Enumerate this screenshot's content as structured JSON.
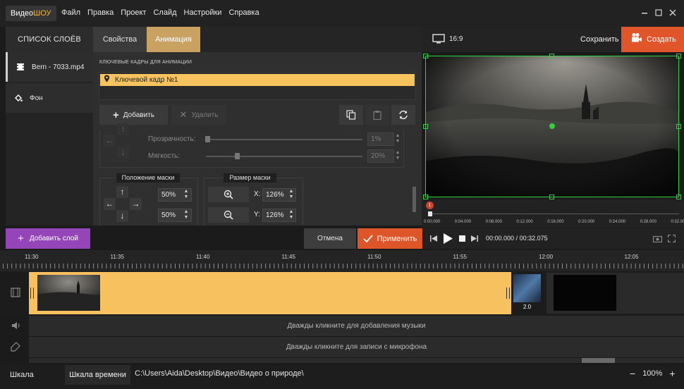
{
  "app": {
    "brand_part1": "Видео",
    "brand_part2": "ШОУ",
    "menu": [
      "Файл",
      "Правка",
      "Проект",
      "Слайд",
      "Настройки",
      "Справка"
    ]
  },
  "layers": {
    "header": "СПИСОК СЛОЁВ",
    "items": [
      {
        "label": "Bern - 7033.mp4",
        "icon": "film-icon"
      },
      {
        "label": "Фон",
        "icon": "paint-bucket-icon"
      }
    ],
    "add_button": "Добавить слой"
  },
  "editor": {
    "tabs": [
      "Свойства",
      "Анимация"
    ],
    "active_tab": "Анимация",
    "keyframes_title": "КЛЮЧЕВЫЕ КАДРЫ ДЛЯ АНИМАЦИИ",
    "keyframes": [
      "Ключевой кадр №1"
    ],
    "add_label": "Добавить",
    "delete_label": "Удалить",
    "opacity_label": "Прозрачность:",
    "opacity_value": "1%",
    "opacity_level": 0.01,
    "softness_label": "Мягкость:",
    "softness_value": "20%",
    "softness_level": 0.2,
    "mask_position_title": "Положение маски",
    "mask_pos_x": "50%",
    "mask_pos_y": "50%",
    "mask_size_title": "Размер маски",
    "size_x_label": "X:",
    "size_x": "126%",
    "size_y_label": "Y:",
    "size_y": "126%",
    "cancel_label": "Отмена",
    "apply_label": "Применить"
  },
  "preview": {
    "aspect": "16:9",
    "save_label": "Сохранить",
    "create_label": "Создать",
    "marker_number": "1",
    "time_ticks": [
      "0:00.000",
      "0:04.000",
      "0:08.000",
      "0:12.000",
      "0:16.000",
      "0:20.000",
      "0:24.000",
      "0:28.000",
      "0:32.000"
    ],
    "current_time": "00:00.000",
    "total_time": "/ 00:32.075",
    "progress": 0
  },
  "timeline": {
    "labels": [
      "11:30",
      "11:35",
      "11:40",
      "11:45",
      "11:50",
      "11:55",
      "12:00",
      "12:05"
    ],
    "clip2_duration": "2.0",
    "music_hint": "Дважды кликните для добавления музыки",
    "mic_hint": "Дважды кликните для записи с микрофона"
  },
  "status": {
    "slides_tab": "Шкала слайдов",
    "timeline_tab": "Шкала времени",
    "path": "C:\\Users\\Aida\\Desktop\\Видео\\Видео о природе\\",
    "zoom": "100%",
    "zoom_minus": "−",
    "zoom_plus": "+"
  },
  "colors": {
    "accent_orange": "#df552a",
    "keyframe_yellow": "#f6c35f",
    "tab_active": "#c9a262",
    "purple": "#9446b9",
    "selection_green": "#2fd23b"
  }
}
